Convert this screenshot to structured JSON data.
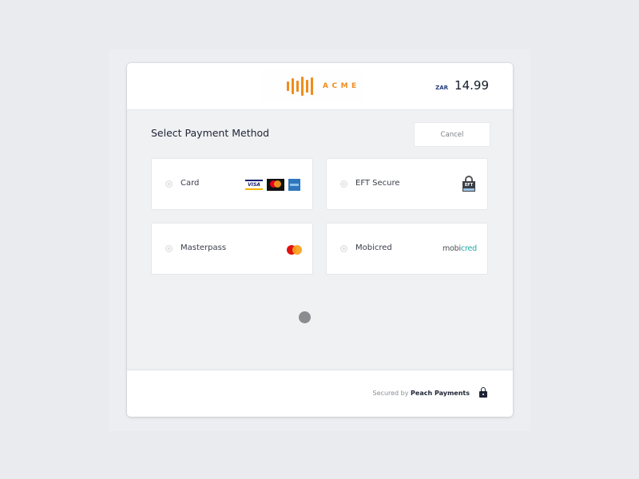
{
  "header": {
    "brand": {
      "name": "ACME",
      "icon": "soundwave-bars-logo",
      "color": "#f08c1c"
    },
    "currency": "ZAR",
    "amount": "14.99"
  },
  "main": {
    "title": "Select Payment Method",
    "cancel_label": "Cancel",
    "options": [
      {
        "label": "Card",
        "selected": false,
        "logos": [
          "visa-icon",
          "mastercard-icon",
          "amex-icon"
        ]
      },
      {
        "label": "EFT Secure",
        "selected": false,
        "logos": [
          "eft-secure-lock-icon"
        ],
        "logo_text": "EFT"
      },
      {
        "label": "Masterpass",
        "selected": false,
        "logos": [
          "masterpass-icon"
        ]
      },
      {
        "label": "Mobicred",
        "selected": false,
        "logos": [
          "mobicred-logo"
        ],
        "logo_text_a": "mobi",
        "logo_text_b": "cred"
      }
    ],
    "visa_text": "VISA"
  },
  "loading": {
    "indicator": "spinner-dot"
  },
  "footer": {
    "secured_prefix": "Secured by ",
    "secured_brand": "Peach Payments",
    "icon": "lock-icon"
  }
}
